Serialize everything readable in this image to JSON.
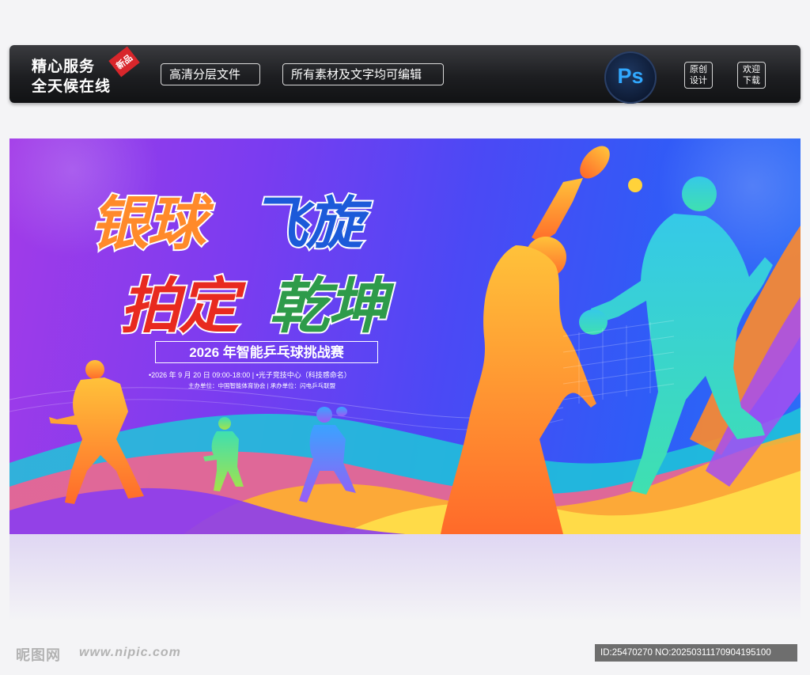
{
  "topbar": {
    "brand_line1": "精心服务",
    "brand_line2": "全天候在线",
    "badge": "新品",
    "pill1": "高清分层文件",
    "pill2": "所有素材及文字均可编辑",
    "ps_label": "Ps",
    "btn1_line1": "原创",
    "btn1_line2": "设计",
    "btn2_line1": "欢迎",
    "btn2_line2": "下载"
  },
  "banner": {
    "title_part1": "银球",
    "title_part2": "飞旋",
    "title_part3": "拍定",
    "title_part4": "乾坤",
    "subtitle": "2026 年智能乒乓球挑战赛",
    "info_line1": "•2026 年 9 月 20 日 09:00-18:00 | •光子竞技中心（科技感命名）",
    "info_line2": "主办单位：中国智能体育协会 | 承办单位：闪电乒乓联盟"
  },
  "footer": {
    "logo": "昵图网",
    "url": "www.nipic.com",
    "id_text": "ID:25470270 NO:20250311170904195100"
  },
  "colors": {
    "topbar_bg": "#1d1e21",
    "banner_purple": "#a23be8",
    "banner_blue": "#2e5df7",
    "orange": "#ff8a2a",
    "teal": "#3fd8d0",
    "ps_blue": "#31a8ff"
  }
}
